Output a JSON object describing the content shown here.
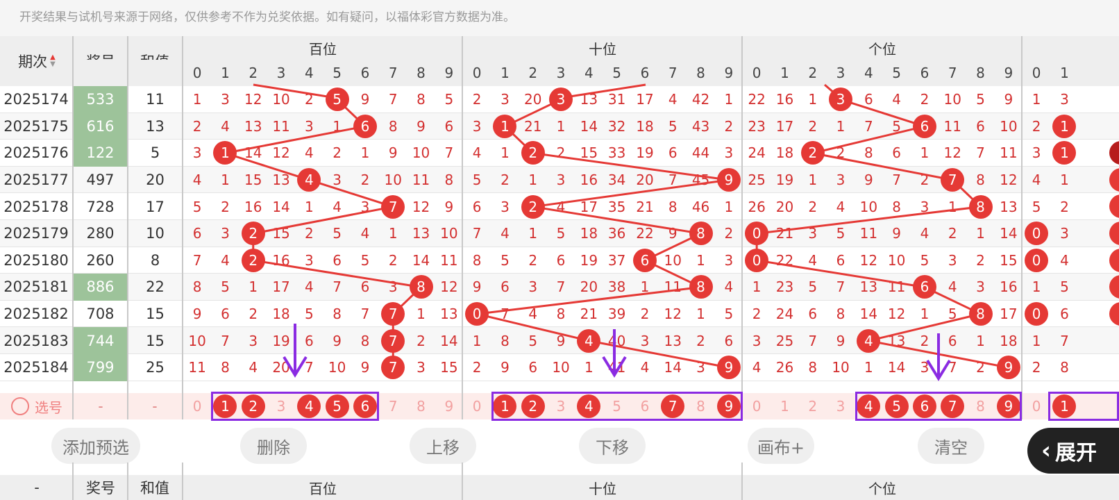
{
  "notice": "开奖结果与试机号来源于网络，仅供参考不作为兑奖依据。如有疑问，以福体彩官方数据为准。",
  "columns": {
    "period": "期次",
    "award": "奖号",
    "sum": "和值",
    "sections": [
      "百位",
      "十位",
      "个位"
    ],
    "digits": [
      "0",
      "1",
      "2",
      "3",
      "4",
      "5",
      "6",
      "7",
      "8",
      "9"
    ]
  },
  "sort_icon": "sort-arrows-icon",
  "colors": {
    "ball": "#e53935",
    "line": "#e53935",
    "green": "#9dc39a",
    "select_box": "#8a2be2"
  },
  "rows": [
    {
      "period": "2025174",
      "award": "533",
      "green": true,
      "sum": "11",
      "bai": [
        "1",
        "3",
        "12",
        "10",
        "2",
        "5",
        "9",
        "7",
        "8",
        "5"
      ],
      "bai_hit": 5,
      "shi": [
        "2",
        "3",
        "20",
        "3",
        "13",
        "31",
        "17",
        "4",
        "42",
        "1"
      ],
      "shi_hit": 3,
      "ge": [
        "22",
        "16",
        "1",
        "3",
        "6",
        "4",
        "2",
        "10",
        "5",
        "9"
      ],
      "ge_hit": 3,
      "extra": [
        "1",
        "3"
      ],
      "extra_hit": -1
    },
    {
      "period": "2025175",
      "award": "616",
      "green": true,
      "sum": "13",
      "bai": [
        "2",
        "4",
        "13",
        "11",
        "3",
        "1",
        "6",
        "8",
        "9",
        "6"
      ],
      "bai_hit": 6,
      "shi": [
        "3",
        "1",
        "21",
        "1",
        "14",
        "32",
        "18",
        "5",
        "43",
        "2"
      ],
      "shi_hit": 1,
      "ge": [
        "23",
        "17",
        "2",
        "1",
        "7",
        "5",
        "6",
        "11",
        "6",
        "10"
      ],
      "ge_hit": 6,
      "extra": [
        "2",
        "1"
      ],
      "extra_hit": 1
    },
    {
      "period": "2025176",
      "award": "122",
      "green": true,
      "sum": "5",
      "bai": [
        "3",
        "1",
        "14",
        "12",
        "4",
        "2",
        "1",
        "9",
        "10",
        "7"
      ],
      "bai_hit": 1,
      "shi": [
        "4",
        "1",
        "2",
        "2",
        "15",
        "33",
        "19",
        "6",
        "44",
        "3"
      ],
      "shi_hit": 2,
      "ge": [
        "24",
        "18",
        "2",
        "2",
        "8",
        "6",
        "1",
        "12",
        "7",
        "11"
      ],
      "ge_hit": 2,
      "extra": [
        "3",
        "1"
      ],
      "extra_hit": 1
    },
    {
      "period": "2025177",
      "award": "497",
      "green": false,
      "sum": "20",
      "bai": [
        "4",
        "1",
        "15",
        "13",
        "4",
        "3",
        "2",
        "10",
        "11",
        "8"
      ],
      "bai_hit": 4,
      "shi": [
        "5",
        "2",
        "1",
        "3",
        "16",
        "34",
        "20",
        "7",
        "45",
        "9"
      ],
      "shi_hit": 9,
      "ge": [
        "25",
        "19",
        "1",
        "3",
        "9",
        "7",
        "2",
        "7",
        "8",
        "12"
      ],
      "ge_hit": 7,
      "extra": [
        "4",
        "1"
      ],
      "extra_hit": -1
    },
    {
      "period": "2025178",
      "award": "728",
      "green": false,
      "sum": "17",
      "bai": [
        "5",
        "2",
        "16",
        "14",
        "1",
        "4",
        "3",
        "7",
        "12",
        "9"
      ],
      "bai_hit": 7,
      "shi": [
        "6",
        "3",
        "2",
        "4",
        "17",
        "35",
        "21",
        "8",
        "46",
        "1"
      ],
      "shi_hit": 2,
      "ge": [
        "26",
        "20",
        "2",
        "4",
        "10",
        "8",
        "3",
        "1",
        "8",
        "13"
      ],
      "ge_hit": 8,
      "extra": [
        "5",
        "2"
      ],
      "extra_hit": -1
    },
    {
      "period": "2025179",
      "award": "280",
      "green": false,
      "sum": "10",
      "bai": [
        "6",
        "3",
        "2",
        "15",
        "2",
        "5",
        "4",
        "1",
        "13",
        "10"
      ],
      "bai_hit": 2,
      "shi": [
        "7",
        "4",
        "1",
        "5",
        "18",
        "36",
        "22",
        "9",
        "8",
        "2"
      ],
      "shi_hit": 8,
      "ge": [
        "0",
        "21",
        "3",
        "5",
        "11",
        "9",
        "4",
        "2",
        "1",
        "14"
      ],
      "ge_hit": 0,
      "extra": [
        "0",
        "3"
      ],
      "extra_hit": 0
    },
    {
      "period": "2025180",
      "award": "260",
      "green": false,
      "sum": "8",
      "bai": [
        "7",
        "4",
        "2",
        "16",
        "3",
        "6",
        "5",
        "2",
        "14",
        "11"
      ],
      "bai_hit": 2,
      "shi": [
        "8",
        "5",
        "2",
        "6",
        "19",
        "37",
        "6",
        "10",
        "1",
        "3"
      ],
      "shi_hit": 6,
      "ge": [
        "0",
        "22",
        "4",
        "6",
        "12",
        "10",
        "5",
        "3",
        "2",
        "15"
      ],
      "ge_hit": 0,
      "extra": [
        "0",
        "4"
      ],
      "extra_hit": 0
    },
    {
      "period": "2025181",
      "award": "886",
      "green": true,
      "sum": "22",
      "bai": [
        "8",
        "5",
        "1",
        "17",
        "4",
        "7",
        "6",
        "3",
        "8",
        "12"
      ],
      "bai_hit": 8,
      "shi": [
        "9",
        "6",
        "3",
        "7",
        "20",
        "38",
        "1",
        "11",
        "8",
        "4"
      ],
      "shi_hit": 8,
      "ge": [
        "1",
        "23",
        "5",
        "7",
        "13",
        "11",
        "6",
        "4",
        "3",
        "16"
      ],
      "ge_hit": 6,
      "extra": [
        "1",
        "5"
      ],
      "extra_hit": -1
    },
    {
      "period": "2025182",
      "award": "708",
      "green": false,
      "sum": "15",
      "bai": [
        "9",
        "6",
        "2",
        "18",
        "5",
        "8",
        "7",
        "7",
        "1",
        "13"
      ],
      "bai_hit": 7,
      "shi": [
        "0",
        "7",
        "4",
        "8",
        "21",
        "39",
        "2",
        "12",
        "1",
        "5"
      ],
      "shi_hit": 0,
      "ge": [
        "2",
        "24",
        "6",
        "8",
        "14",
        "12",
        "1",
        "5",
        "8",
        "17"
      ],
      "ge_hit": 8,
      "extra": [
        "0",
        "6"
      ],
      "extra_hit": 0
    },
    {
      "period": "2025183",
      "award": "744",
      "green": true,
      "sum": "15",
      "bai": [
        "10",
        "7",
        "3",
        "19",
        "6",
        "9",
        "8",
        "7",
        "2",
        "14"
      ],
      "bai_hit": 7,
      "shi": [
        "1",
        "8",
        "5",
        "9",
        "4",
        "40",
        "3",
        "13",
        "2",
        "6"
      ],
      "shi_hit": 4,
      "ge": [
        "3",
        "25",
        "7",
        "9",
        "4",
        "13",
        "2",
        "6",
        "1",
        "18"
      ],
      "ge_hit": 4,
      "extra": [
        "1",
        "7"
      ],
      "extra_hit": -1
    },
    {
      "period": "2025184",
      "award": "799",
      "green": true,
      "sum": "25",
      "bai": [
        "11",
        "8",
        "4",
        "20",
        "7",
        "10",
        "9",
        "7",
        "3",
        "15"
      ],
      "bai_hit": 7,
      "shi": [
        "2",
        "9",
        "6",
        "10",
        "1",
        "41",
        "4",
        "14",
        "3",
        "9"
      ],
      "shi_hit": 9,
      "ge": [
        "4",
        "26",
        "8",
        "10",
        "1",
        "14",
        "3",
        "7",
        "2",
        "9"
      ],
      "ge_hit": 9,
      "extra": [
        "2",
        "8"
      ],
      "extra_hit": -1
    }
  ],
  "select_row": {
    "label": "选号",
    "award_dash": "-",
    "sum_dash": "-",
    "bai_selected": [
      1,
      2,
      4,
      5,
      6
    ],
    "shi_selected": [
      1,
      2,
      4,
      7,
      9
    ],
    "ge_selected": [
      4,
      5,
      6,
      7,
      9
    ],
    "extra_selected": [
      1
    ]
  },
  "toolbar": {
    "add_preselect": "添加预选",
    "delete": "删除",
    "move_up": "上移",
    "move_down": "下移",
    "canvas_plus": "画布+",
    "clear": "清空",
    "expand": "展开"
  },
  "bottom_header": {
    "period": "-",
    "award": "奖号",
    "sum": "和值",
    "sections": [
      "百位",
      "十位",
      "个位"
    ]
  }
}
